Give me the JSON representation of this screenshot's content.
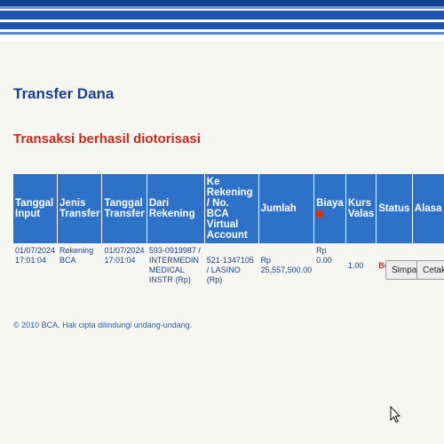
{
  "page": {
    "title": "Transfer Dana",
    "success_message": "Transaksi berhasil diotorisasi"
  },
  "table": {
    "headers": {
      "tanggal_input": [
        "Tanggal",
        "Input"
      ],
      "jenis_transfer": [
        "Jenis",
        "Transfer"
      ],
      "tanggal_transfer": [
        "Tanggal",
        "Transfer"
      ],
      "dari_rekening": "Dari Rekening",
      "ke_rekening": [
        "Ke Rekening / No.",
        "BCA Virtual Account"
      ],
      "jumlah": "Jumlah",
      "biaya": "Biaya",
      "kurs_valas": [
        "Kurs",
        "Valas"
      ],
      "status": "Status",
      "alasan": "Alasa"
    },
    "row": {
      "tanggal_input": [
        "01/07/2024",
        "17:01:04"
      ],
      "jenis_transfer": [
        "Rekening",
        "BCA"
      ],
      "tanggal_transfer": [
        "01/07/2024",
        "17:01:04"
      ],
      "dari_rekening": [
        "593-0919987 / INTERMEDIN",
        "MEDICAL INSTR (Rp)"
      ],
      "ke_rekening": "521-1347105 / LASINO (Rp)",
      "jumlah": "Rp 25,557,500.00",
      "biaya": [
        "Rp",
        "0.00"
      ],
      "kurs_valas": "1.00",
      "status": "Berhasil",
      "alasan": "-"
    }
  },
  "buttons": {
    "save": "Simpan",
    "print": "Cetak"
  },
  "footer": {
    "copyright": "© 2010 BCA. Hak cipta dilindungi undang-undang."
  },
  "colors": {
    "header_blue": "#1a55b0",
    "table_header": "#2d71c8",
    "title_blue": "#1b3f8a",
    "success_red": "#c62a1a"
  },
  "icons": {
    "biaya_header": "red-square-icon",
    "cursor": "mouse-pointer-icon"
  }
}
